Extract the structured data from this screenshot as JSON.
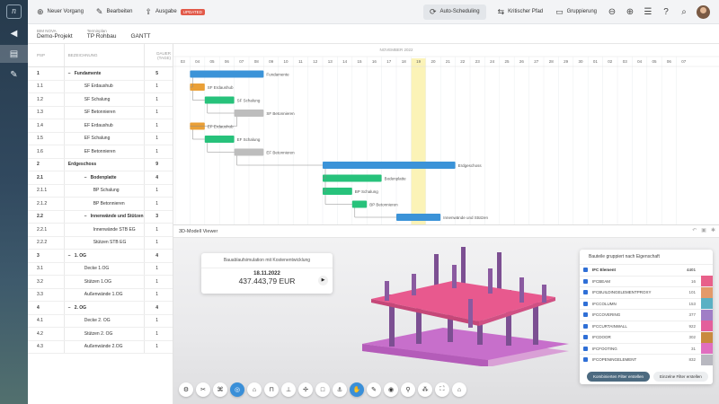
{
  "app": {
    "logo_glyph": "n"
  },
  "sidebar": {
    "items": [
      {
        "icon": "chevron-left-icon",
        "glyph": "◀"
      },
      {
        "icon": "table-icon",
        "glyph": "▤"
      },
      {
        "icon": "pencil-icon",
        "glyph": "✎"
      }
    ]
  },
  "toolbar": {
    "new_label": "Neuer Vorgang",
    "edit_label": "Bearbeiten",
    "output_label": "Ausgabe",
    "badge": "UPDATED",
    "auto_label": "Auto-Scheduling",
    "critical_label": "Kritischer Pfad",
    "group_label": "Gruppierung"
  },
  "project": {
    "label_project": "BIM NOVA",
    "project_name": "Demo-Projekt",
    "label_plan": "Terminplan",
    "plan_name": "TP Rohbau",
    "view": "GANTT"
  },
  "table": {
    "headers": {
      "psp": "PSP",
      "desc": "BEZEICHNUNG",
      "dur": "DAUER (TAGE)"
    },
    "rows": [
      {
        "psp": "1",
        "name": "Fundamente",
        "dur": "5",
        "level": 0,
        "bold": true,
        "group": true
      },
      {
        "psp": "1.1",
        "name": "SF Erdaushub",
        "dur": "1",
        "level": 1
      },
      {
        "psp": "1.2",
        "name": "SF Schalung",
        "dur": "1",
        "level": 1
      },
      {
        "psp": "1.3",
        "name": "SF Betonnieren",
        "dur": "1",
        "level": 1
      },
      {
        "psp": "1.4",
        "name": "EF Erdaushub",
        "dur": "1",
        "level": 1
      },
      {
        "psp": "1.5",
        "name": "EF Schalung",
        "dur": "1",
        "level": 1
      },
      {
        "psp": "1.6",
        "name": "EF Betonnieren",
        "dur": "1",
        "level": 1
      },
      {
        "psp": "2",
        "name": "Erdgeschoss",
        "dur": "9",
        "level": 0,
        "bold": true
      },
      {
        "psp": "2.1",
        "name": "Bodenplatte",
        "dur": "4",
        "level": 1,
        "bold": true,
        "group": true
      },
      {
        "psp": "2.1.1",
        "name": "BP Schalung",
        "dur": "1",
        "level": 2
      },
      {
        "psp": "2.1.2",
        "name": "BP Betonnieren",
        "dur": "1",
        "level": 2
      },
      {
        "psp": "2.2",
        "name": "Innenwände und Stützen",
        "dur": "3",
        "level": 1,
        "bold": true,
        "group": true
      },
      {
        "psp": "2.2.1",
        "name": "Innenwände STB EG",
        "dur": "1",
        "level": 2
      },
      {
        "psp": "2.2.2",
        "name": "Stützen STB EG",
        "dur": "1",
        "level": 2
      },
      {
        "psp": "3",
        "name": "1. OG",
        "dur": "4",
        "level": 0,
        "bold": true,
        "group": true
      },
      {
        "psp": "3.1",
        "name": "Decke 1.OG",
        "dur": "1",
        "level": 1
      },
      {
        "psp": "3.2",
        "name": "Stützen 1.OG",
        "dur": "1",
        "level": 1
      },
      {
        "psp": "3.3",
        "name": "Außenwände 1.OG",
        "dur": "1",
        "level": 1
      },
      {
        "psp": "4",
        "name": "2. OG",
        "dur": "4",
        "level": 0,
        "bold": true,
        "group": true
      },
      {
        "psp": "4.1",
        "name": "Decke 2. OG",
        "dur": "1",
        "level": 1
      },
      {
        "psp": "4.2",
        "name": "Stützen 2. OG",
        "dur": "1",
        "level": 1
      },
      {
        "psp": "4.3",
        "name": "Außenwände 2.OG",
        "dur": "1",
        "level": 1
      }
    ]
  },
  "gantt": {
    "month": "NOVEMBER 2022",
    "days": [
      "03",
      "04",
      "05",
      "06",
      "07",
      "08",
      "09",
      "10",
      "11",
      "12",
      "13",
      "14",
      "15",
      "16",
      "17",
      "18",
      "19",
      "20",
      "21",
      "22",
      "23",
      "24",
      "25",
      "26",
      "27",
      "28",
      "29",
      "30",
      "01",
      "02",
      "03",
      "04",
      "05",
      "06",
      "07"
    ],
    "today_index": 16,
    "bars": [
      {
        "row": 0,
        "start": 1,
        "len": 5,
        "color": "#3b93d8",
        "label": "Fundamente"
      },
      {
        "row": 1,
        "start": 1,
        "len": 1,
        "color": "#eaa037",
        "label": "SF Erdaushub"
      },
      {
        "row": 2,
        "start": 2,
        "len": 2,
        "color": "#27c27b",
        "label": "SF Schalung"
      },
      {
        "row": 3,
        "start": 4,
        "len": 2,
        "color": "#bdbdbd",
        "label": "SF Betonnieren"
      },
      {
        "row": 4,
        "start": 1,
        "len": 1,
        "color": "#eaa037",
        "label": "EF Erdaushub"
      },
      {
        "row": 5,
        "start": 2,
        "len": 2,
        "color": "#27c27b",
        "label": "EF Schalung"
      },
      {
        "row": 6,
        "start": 4,
        "len": 2,
        "color": "#bdbdbd",
        "label": "EF Betonnieren"
      },
      {
        "row": 7,
        "start": 10,
        "len": 9,
        "color": "#3b93d8",
        "label": "Erdgeschoss"
      },
      {
        "row": 8,
        "start": 10,
        "len": 4,
        "color": "#27c27b",
        "label": "Bodenplatte"
      },
      {
        "row": 9,
        "start": 10,
        "len": 2,
        "color": "#27c27b",
        "label": "BP Schalung"
      },
      {
        "row": 10,
        "start": 12,
        "len": 1,
        "color": "#27c27b",
        "label": "BP Betonnieren"
      },
      {
        "row": 11,
        "start": 15,
        "len": 3,
        "color": "#3b93d8",
        "label": "Innenwände und Stützen"
      }
    ]
  },
  "viewer": {
    "title": "3D-Modell Viewer",
    "sim_title": "Bauablaufsimulation mit Kostenentwicklung",
    "sim_date": "18.11.2022",
    "sim_amount": "437.443,79 EUR"
  },
  "ifc_panel": {
    "title": "Bauteile gruppiert nach Eigenschaft",
    "col_name": "IFC Element",
    "col_count": "4401",
    "rows": [
      {
        "name": "IFCBEAM",
        "count": "16",
        "color": "#e8608a"
      },
      {
        "name": "IFCBUILDINGELEMENTPROXY",
        "count": "101",
        "color": "#e39a6a"
      },
      {
        "name": "IFCCOLUMN",
        "count": "153",
        "color": "#5ab0c4"
      },
      {
        "name": "IFCCOVERING",
        "count": "377",
        "color": "#a07ec6"
      },
      {
        "name": "IFCCURTAINWALL",
        "count": "922",
        "color": "#e35f9c"
      },
      {
        "name": "IFCDOOR",
        "count": "302",
        "color": "#c98a3f"
      },
      {
        "name": "IFCFOOTING",
        "count": "31",
        "color": "#e06ec0"
      },
      {
        "name": "IFCOPENINGELEMENT",
        "count": "832",
        "color": "#b8b8c0"
      }
    ],
    "btn_combined": "Kombinierten Filter erstellen",
    "btn_single": "Einzelne Filter erstellen"
  }
}
